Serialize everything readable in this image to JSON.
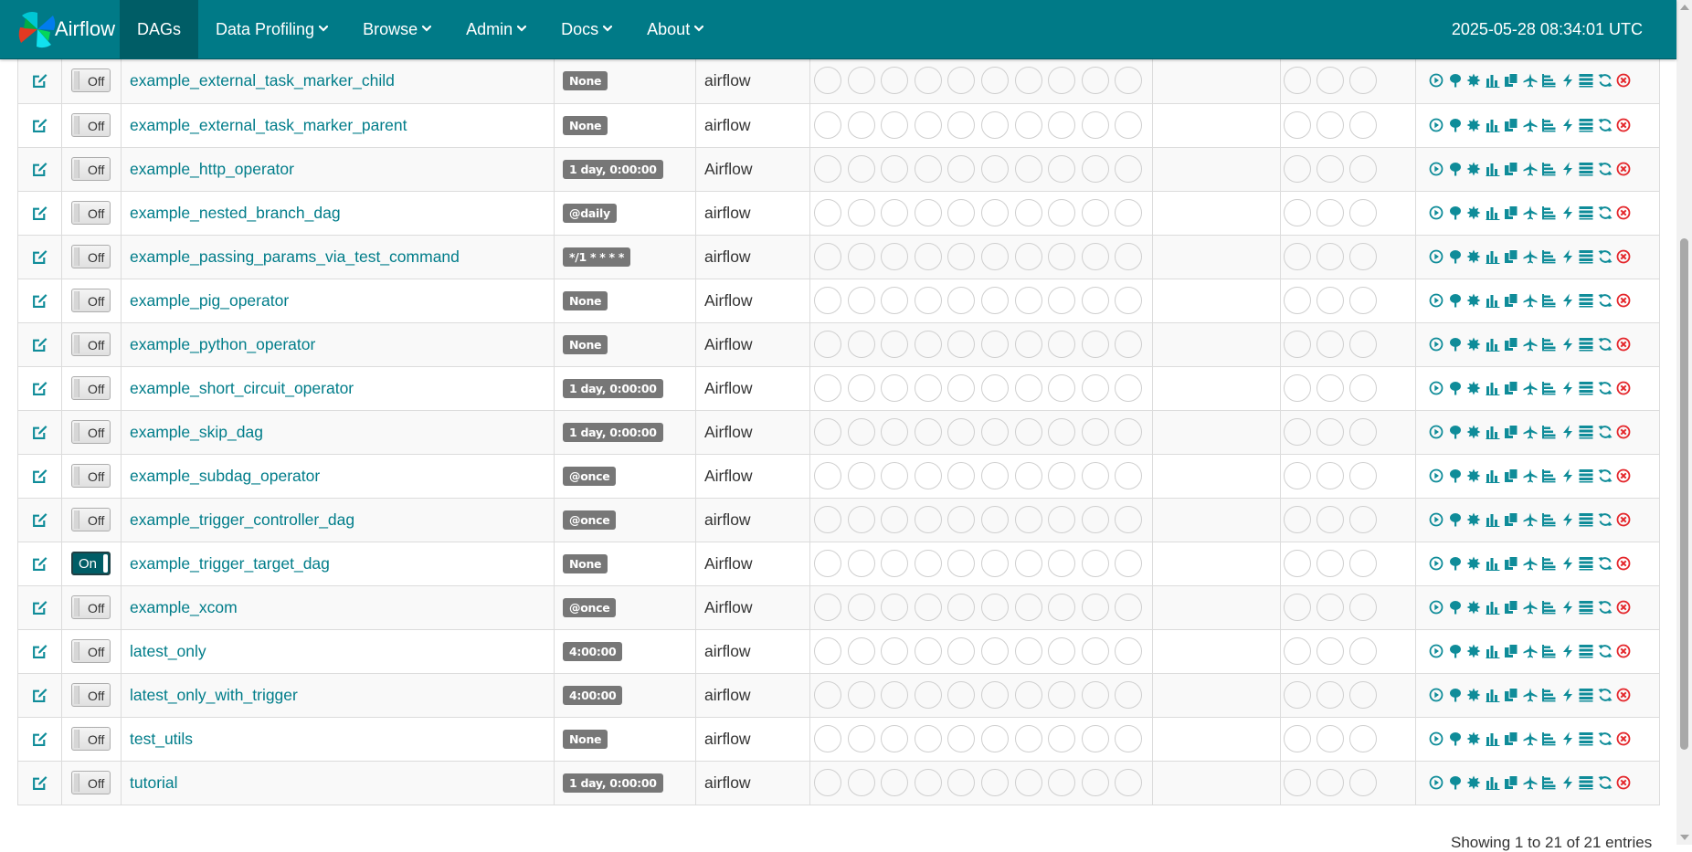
{
  "navbar": {
    "brand": "Airflow",
    "items": [
      {
        "label": "DAGs",
        "dropdown": false,
        "active": true
      },
      {
        "label": "Data Profiling",
        "dropdown": true
      },
      {
        "label": "Browse",
        "dropdown": true
      },
      {
        "label": "Admin",
        "dropdown": true
      },
      {
        "label": "Docs",
        "dropdown": true
      },
      {
        "label": "About",
        "dropdown": true
      }
    ],
    "clock": "2025-05-28 08:34:01 UTC"
  },
  "colors": {
    "accent": "#007A87",
    "link": "#017d8a",
    "badge": "#777777",
    "delete": "#e4262b"
  },
  "link_icons": [
    "trigger-dag-icon",
    "tree-view-icon",
    "graph-view-icon",
    "task-duration-icon",
    "task-tries-icon",
    "landing-times-icon",
    "gantt-icon",
    "code-icon",
    "logs-icon",
    "refresh-icon",
    "delete-icon"
  ],
  "rows": [
    {
      "dag": "example_external_task_marker_child",
      "toggle": "Off",
      "schedule": "None",
      "owner": "airflow"
    },
    {
      "dag": "example_external_task_marker_parent",
      "toggle": "Off",
      "schedule": "None",
      "owner": "airflow"
    },
    {
      "dag": "example_http_operator",
      "toggle": "Off",
      "schedule": "1 day, 0:00:00",
      "owner": "Airflow"
    },
    {
      "dag": "example_nested_branch_dag",
      "toggle": "Off",
      "schedule": "@daily",
      "owner": "airflow"
    },
    {
      "dag": "example_passing_params_via_test_command",
      "toggle": "Off",
      "schedule": "*/1 * * * *",
      "owner": "airflow"
    },
    {
      "dag": "example_pig_operator",
      "toggle": "Off",
      "schedule": "None",
      "owner": "Airflow"
    },
    {
      "dag": "example_python_operator",
      "toggle": "Off",
      "schedule": "None",
      "owner": "Airflow"
    },
    {
      "dag": "example_short_circuit_operator",
      "toggle": "Off",
      "schedule": "1 day, 0:00:00",
      "owner": "Airflow"
    },
    {
      "dag": "example_skip_dag",
      "toggle": "Off",
      "schedule": "1 day, 0:00:00",
      "owner": "Airflow"
    },
    {
      "dag": "example_subdag_operator",
      "toggle": "Off",
      "schedule": "@once",
      "owner": "Airflow"
    },
    {
      "dag": "example_trigger_controller_dag",
      "toggle": "Off",
      "schedule": "@once",
      "owner": "airflow"
    },
    {
      "dag": "example_trigger_target_dag",
      "toggle": "On",
      "schedule": "None",
      "owner": "Airflow"
    },
    {
      "dag": "example_xcom",
      "toggle": "Off",
      "schedule": "@once",
      "owner": "Airflow"
    },
    {
      "dag": "latest_only",
      "toggle": "Off",
      "schedule": "4:00:00",
      "owner": "airflow"
    },
    {
      "dag": "latest_only_with_trigger",
      "toggle": "Off",
      "schedule": "4:00:00",
      "owner": "airflow"
    },
    {
      "dag": "test_utils",
      "toggle": "Off",
      "schedule": "None",
      "owner": "airflow"
    },
    {
      "dag": "tutorial",
      "toggle": "Off",
      "schedule": "1 day, 0:00:00",
      "owner": "airflow"
    }
  ],
  "footer": {
    "info": "Showing 1 to 21 of 21 entries"
  }
}
